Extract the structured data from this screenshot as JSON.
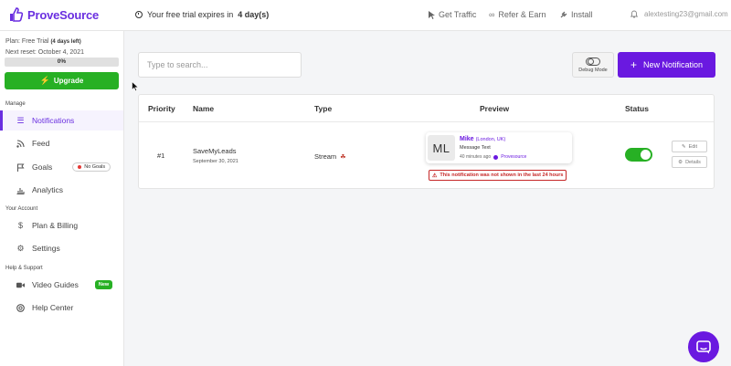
{
  "app": {
    "name": "ProveSource"
  },
  "topbar": {
    "trial_prefix": "Your free trial expires in",
    "trial_days": "4 day(s)",
    "get_traffic": "Get Traffic",
    "refer_earn": "Refer & Earn",
    "install": "Install",
    "user_email": "alextesting23@gmail.com"
  },
  "sidebar": {
    "plan_label": "Plan:",
    "plan_value": "Free Trial",
    "plan_days": "(4 days left)",
    "next_reset": "Next reset: October 4, 2021",
    "usage_percent": 0,
    "usage_label": "0%",
    "upgrade_label": "Upgrade",
    "sections": {
      "manage": "Manage",
      "account": "Your Account",
      "help": "Help & Support"
    },
    "items": {
      "notifications": "Notifications",
      "feed": "Feed",
      "goals": "Goals",
      "goals_badge": "No Goals",
      "analytics": "Analytics",
      "plan_billing": "Plan & Billing",
      "settings": "Settings",
      "video_guides": "Video Guides",
      "video_badge": "New",
      "help_center": "Help Center"
    }
  },
  "main": {
    "search_placeholder": "Type to search...",
    "debug_label": "Debug Mode",
    "new_notification_label": "New Notification",
    "table": {
      "headers": {
        "priority": "Priority",
        "name": "Name",
        "type": "Type",
        "preview": "Preview",
        "status": "Status"
      },
      "rows": [
        {
          "priority": "#1",
          "name": "SaveMyLeads",
          "date": "September 30, 2021",
          "type": "Stream",
          "preview": {
            "initials": "ML",
            "person": "Mike",
            "location": "(London, UK)",
            "message": "Message Text",
            "time": "40 minutes ago",
            "source": "Provesource"
          },
          "warning": "This notification was not shown in the last 24 hours",
          "status_on": true,
          "edit_label": "Edit",
          "details_label": "Details"
        }
      ]
    }
  },
  "colors": {
    "brand": "#6a19e0",
    "success": "#27b024",
    "danger": "#c62828"
  }
}
